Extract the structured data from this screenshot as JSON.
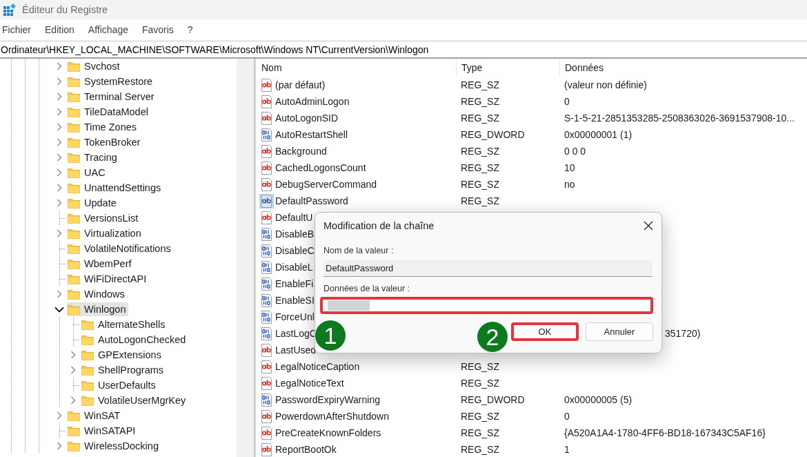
{
  "window": {
    "title": "Éditeur du Registre"
  },
  "menu": [
    "Fichier",
    "Edition",
    "Affichage",
    "Favoris",
    "?"
  ],
  "address": "Ordinateur\\HKEY_LOCAL_MACHINE\\SOFTWARE\\Microsoft\\Windows NT\\CurrentVersion\\Winlogon",
  "tree": [
    {
      "kind": "key",
      "label": "Svchost",
      "expanded": false,
      "selected": false
    },
    {
      "kind": "key",
      "label": "SystemRestore",
      "expanded": false,
      "selected": false
    },
    {
      "kind": "key",
      "label": "Terminal Server",
      "expanded": false,
      "selected": false
    },
    {
      "kind": "key",
      "label": "TileDataModel",
      "expanded": false,
      "selected": false
    },
    {
      "kind": "key",
      "label": "Time Zones",
      "expanded": false,
      "selected": false
    },
    {
      "kind": "key",
      "label": "TokenBroker",
      "expanded": false,
      "selected": false
    },
    {
      "kind": "key",
      "label": "Tracing",
      "expanded": false,
      "selected": false
    },
    {
      "kind": "key",
      "label": "UAC",
      "expanded": false,
      "selected": false
    },
    {
      "kind": "key",
      "label": "UnattendSettings",
      "expanded": false,
      "selected": false
    },
    {
      "kind": "key",
      "label": "Update",
      "expanded": false,
      "selected": false
    },
    {
      "kind": "leaf",
      "label": "VersionsList",
      "selected": false
    },
    {
      "kind": "key",
      "label": "Virtualization",
      "expanded": false,
      "selected": false
    },
    {
      "kind": "leaf",
      "label": "VolatileNotifications",
      "selected": false
    },
    {
      "kind": "leaf",
      "label": "WbemPerf",
      "selected": false
    },
    {
      "kind": "leaf",
      "label": "WiFiDirectAPI",
      "selected": false
    },
    {
      "kind": "key",
      "label": "Windows",
      "expanded": false,
      "selected": false
    },
    {
      "kind": "key",
      "label": "Winlogon",
      "expanded": true,
      "selected": true,
      "children": [
        {
          "kind": "leaf",
          "label": "AlternateShells",
          "selected": false
        },
        {
          "kind": "leaf",
          "label": "AutoLogonChecked",
          "selected": false
        },
        {
          "kind": "key",
          "label": "GPExtensions",
          "expanded": false,
          "selected": false
        },
        {
          "kind": "key",
          "label": "ShellPrograms",
          "expanded": false,
          "selected": false
        },
        {
          "kind": "leaf",
          "label": "UserDefaults",
          "selected": false
        },
        {
          "kind": "key",
          "label": "VolatileUserMgrKey",
          "expanded": false,
          "selected": false
        }
      ]
    },
    {
      "kind": "key",
      "label": "WinSAT",
      "expanded": false,
      "selected": false
    },
    {
      "kind": "leaf",
      "label": "WinSATAPI",
      "selected": false
    },
    {
      "kind": "key",
      "label": "WirelessDocking",
      "expanded": false,
      "selected": false
    }
  ],
  "table": {
    "columns": [
      "Nom",
      "Type",
      "Données"
    ],
    "rows": [
      {
        "kind": "string",
        "name": "(par défaut)",
        "type": "REG_SZ",
        "data": "(valeur non définie)",
        "selected": false
      },
      {
        "kind": "string",
        "name": "AutoAdminLogon",
        "type": "REG_SZ",
        "data": "0",
        "selected": false
      },
      {
        "kind": "string",
        "name": "AutoLogonSID",
        "type": "REG_SZ",
        "data": "S-1-5-21-2851353285-2508363026-3691537908-10...",
        "selected": false
      },
      {
        "kind": "binary",
        "name": "AutoRestartShell",
        "type": "REG_DWORD",
        "data": "0x00000001 (1)",
        "selected": false
      },
      {
        "kind": "string",
        "name": "Background",
        "type": "REG_SZ",
        "data": "0 0 0",
        "selected": false
      },
      {
        "kind": "string",
        "name": "CachedLogonsCount",
        "type": "REG_SZ",
        "data": "10",
        "selected": false
      },
      {
        "kind": "string",
        "name": "DebugServerCommand",
        "type": "REG_SZ",
        "data": "no",
        "selected": false
      },
      {
        "kind": "string",
        "name": "DefaultPassword",
        "type": "REG_SZ",
        "selected": true
      },
      {
        "kind": "string",
        "name": "DefaultU",
        "selected": false
      },
      {
        "kind": "binary",
        "name": "DisableB",
        "selected": false
      },
      {
        "kind": "binary",
        "name": "DisableC",
        "selected": false
      },
      {
        "kind": "binary",
        "name": "DisableL",
        "selected": false
      },
      {
        "kind": "binary",
        "name": "EnableFi",
        "selected": false
      },
      {
        "kind": "binary",
        "name": "EnableSI",
        "selected": false
      },
      {
        "kind": "binary",
        "name": "ForceUnl",
        "selected": false
      },
      {
        "kind": "binary",
        "name": "LastLogC",
        "data": "351720)",
        "selected": false
      },
      {
        "kind": "string",
        "name": "LastUsed",
        "selected": false
      },
      {
        "kind": "string",
        "name": "LegalNoticeCaption",
        "type": "REG_SZ",
        "selected": false
      },
      {
        "kind": "string",
        "name": "LegalNoticeText",
        "type": "REG_SZ",
        "selected": false
      },
      {
        "kind": "binary",
        "name": "PasswordExpiryWarning",
        "type": "REG_DWORD",
        "data": "0x00000005 (5)",
        "selected": false
      },
      {
        "kind": "string",
        "name": "PowerdownAfterShutdown",
        "type": "REG_SZ",
        "data": "0",
        "selected": false
      },
      {
        "kind": "string",
        "name": "PreCreateKnownFolders",
        "type": "REG_SZ",
        "data": "{A520A1A4-1780-4FF6-BD18-167343C5AF16}",
        "selected": false
      },
      {
        "kind": "string",
        "name": "ReportBootOk",
        "type": "REG_SZ",
        "data": "1",
        "selected": false
      }
    ]
  },
  "dialog": {
    "title": "Modification de la chaîne",
    "name_label": "Nom de la valeur :",
    "name_value": "DefaultPassword",
    "data_label": "Données de la valeur :",
    "data_highlighted": true,
    "buttons": [
      {
        "label": "OK",
        "highlighted": true
      },
      {
        "label": "Annuler",
        "highlighted": false
      }
    ]
  },
  "annotations": [
    {
      "label": "1"
    },
    {
      "label": "2"
    }
  ]
}
